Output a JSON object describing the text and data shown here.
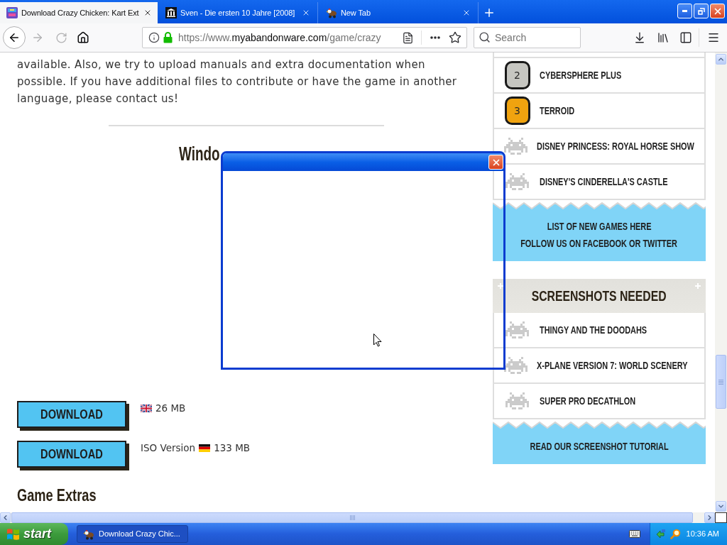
{
  "tabs": [
    {
      "kind": "game",
      "title": "Download Crazy Chicken: Kart Ext",
      "selected": true
    },
    {
      "kind": "building",
      "title": "Sven - Die ersten 10 Jahre [2008]",
      "selected": false
    },
    {
      "kind": "bird",
      "title": "New Tab",
      "selected": false
    }
  ],
  "toolbar": {
    "back": {
      "disabled": false
    },
    "forward": {
      "disabled": true
    },
    "reload": {
      "disabled": true
    },
    "url_parts": [
      {
        "kind": "dim",
        "text": "https://www."
      },
      {
        "kind": "host",
        "text": "myabandonware.com"
      },
      {
        "kind": "dim",
        "text": "/game/crazy"
      }
    ],
    "search": {
      "placeholder": "Search"
    }
  },
  "page": {
    "paragraph_lines": [
      "available. Also, we try to upload manuals and extra documentation when",
      "possible. If you have additional files to contribute or have the game in another",
      "language, please contact us!"
    ],
    "section_heading": "Windo",
    "downloads": [
      {
        "button": "DOWNLOAD",
        "flag": {
          "kind": "uk"
        },
        "size": "26 MB"
      },
      {
        "button": "DOWNLOAD",
        "version": "ISO Version",
        "flag": {
          "kind": "de"
        },
        "size": "133 MB"
      }
    ],
    "extras_heading": "Game Extras"
  },
  "sidebar": {
    "top_games": {
      "items": [
        {
          "kind": "ranked",
          "rank": "2",
          "color": "#c6c6c1",
          "title": "CYBERSPHERE PLUS"
        },
        {
          "kind": "ranked",
          "rank": "3",
          "color": "#f0a30f",
          "title": "TERROID"
        },
        {
          "kind": "game",
          "title": "DISNEY PRINCESS: ROYAL HORSE SHOW"
        },
        {
          "kind": "game",
          "title": "DISNEY'S CINDERELLA'S CASTLE"
        }
      ],
      "links": [
        "LIST OF NEW GAMES HERE",
        "FOLLOW US ON FACEBOOK OR TWITTER"
      ]
    },
    "screenshots_needed": {
      "title": "SCREENSHOTS NEEDED",
      "items": [
        {
          "kind": "game",
          "title": "THINGY AND THE DOODAHS"
        },
        {
          "kind": "game",
          "title": "X-PLANE VERSION 7: WORLD SCENERY"
        },
        {
          "kind": "game",
          "title": "SUPER PRO DECATHLON"
        }
      ],
      "links": [
        "READ OUR SCREENSHOT TUTORIAL"
      ]
    }
  },
  "taskbar": {
    "start": "start",
    "tasks": [
      {
        "kind": "bird",
        "title": "Download Crazy Chic...",
        "selected": true
      }
    ],
    "clock": "10:36 AM"
  }
}
